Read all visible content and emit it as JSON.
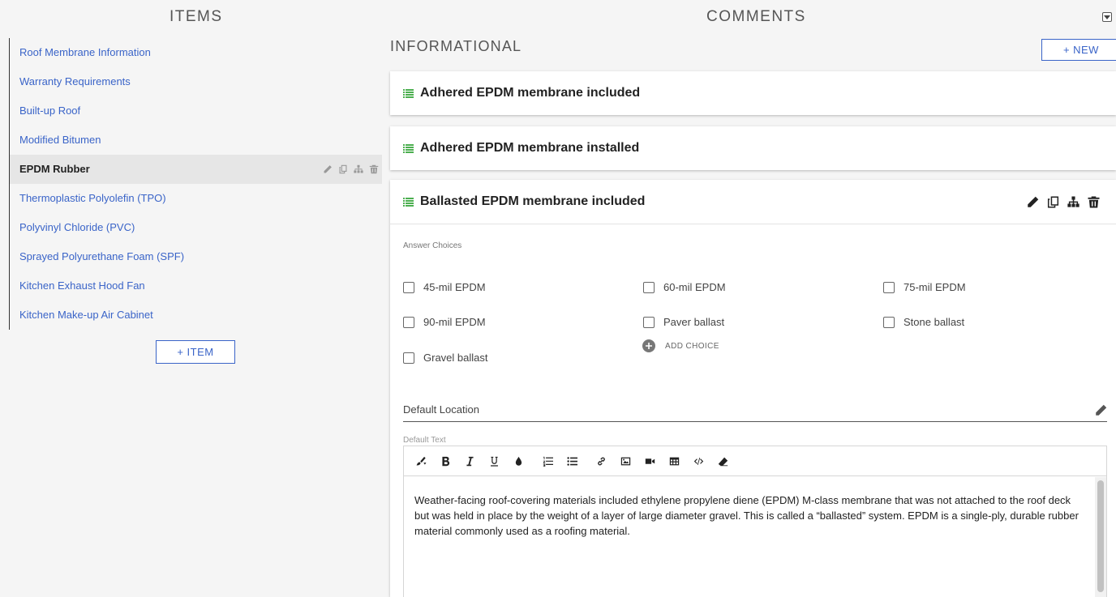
{
  "items_panel": {
    "title": "ITEMS",
    "items": [
      {
        "label": "Roof Membrane Information",
        "active": false
      },
      {
        "label": "Warranty Requirements",
        "active": false
      },
      {
        "label": "Built-up Roof",
        "active": false
      },
      {
        "label": "Modified Bitumen",
        "active": false
      },
      {
        "label": "EPDM Rubber",
        "active": true
      },
      {
        "label": "Thermoplastic Polyolefin (TPO)",
        "active": false
      },
      {
        "label": "Polyvinyl Chloride (PVC)",
        "active": false
      },
      {
        "label": "Sprayed Polyurethane Foam (SPF)",
        "active": false
      },
      {
        "label": "Kitchen Exhaust Hood Fan",
        "active": false
      },
      {
        "label": "Kitchen Make-up Air Cabinet",
        "active": false
      }
    ],
    "add_item_label": "ITEM"
  },
  "comments_panel": {
    "title": "COMMENTS",
    "section_title": "INFORMATIONAL",
    "new_button_label": "NEW",
    "cards": [
      {
        "title": "Adhered EPDM membrane included"
      },
      {
        "title": "Adhered EPDM membrane installed"
      },
      {
        "title": "Ballasted EPDM membrane included"
      }
    ],
    "expanded": {
      "answer_choices_label": "Answer Choices",
      "choices": [
        "45-mil EPDM",
        "60-mil EPDM",
        "75-mil EPDM",
        "90-mil EPDM",
        "Paver ballast",
        "Stone ballast",
        "Gravel ballast"
      ],
      "add_choice_label": "ADD CHOICE",
      "default_location_label": "Default Location",
      "default_text_label": "Default Text",
      "default_text": "Weather-facing roof-covering materials included ethylene propylene diene (EPDM) M-class membrane that was not attached to the roof deck but was held in place by the weight of a layer of large diameter gravel. This is called a “ballasted” system. EPDM is a single-ply, durable rubber material commonly used as a roofing material."
    }
  },
  "colors": {
    "link": "#3a64c8",
    "list_icon": "#4caf50",
    "active_row_bg": "#e6e6e6",
    "page_bg": "#f5f5f5"
  },
  "icons": {
    "row_actions": [
      "pencil-icon",
      "copy-icon",
      "sitemap-icon",
      "trash-icon"
    ],
    "card_icon": "list-icon",
    "toolbar": [
      "paint-brush-icon",
      "bold-icon",
      "italic-icon",
      "underline-icon",
      "drop-icon",
      "ordered-list-icon",
      "unordered-list-icon",
      "link-icon",
      "image-icon",
      "video-icon",
      "table-icon",
      "code-icon",
      "eraser-icon"
    ]
  }
}
